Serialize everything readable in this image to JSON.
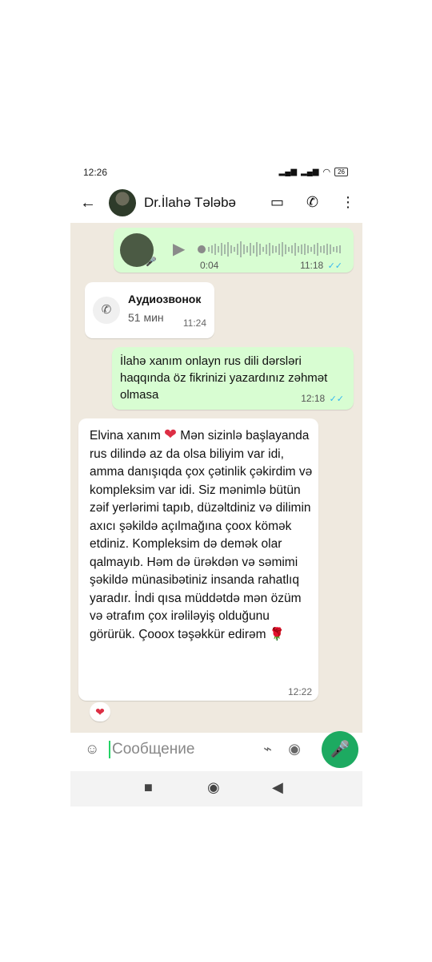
{
  "status": {
    "time": "12:26",
    "battery": "26"
  },
  "header": {
    "contact_name": "Dr.İlahə Tələbə"
  },
  "messages": {
    "voice": {
      "duration": "0:04",
      "time": "11:18"
    },
    "call": {
      "title": "Аудиозвонок",
      "duration": "51 мин",
      "time": "11:24"
    },
    "question": {
      "text": "İlahə xanım onlayn rus dili dərsləri haqqında öz fikrinizi yazardınız zəhmət olmasa",
      "time": "12:18"
    },
    "reply": {
      "text1": "Elvina xanım",
      "text2": "Mən sizinlə başlayanda rus dilində az da olsa biliyim var idi, amma danışıqda çox çətinlik çəkirdim və kompleksim var idi. Siz mənimlə bütün zəif yerlərimi tapıb, düzəltdiniz və dilimin axıcı şəkildə açılmağına çoox kömək etdiniz. Kompleksim də demək olar qalmayıb. Həm də ürəkdən və səmimi şəkildə münasibətiniz insanda rahatlıq yaradır. İndi qısa müddətdə mən özüm və ətrafım çox irəliləyiş olduğunu görürük.",
      "text3": "Çooox təşəkkür edirəm",
      "time": "12:22",
      "reaction": "❤"
    }
  },
  "composer": {
    "placeholder": "Сообщение"
  },
  "icons": {
    "back": "←",
    "video": "▭",
    "phone": "✆",
    "more": "⋮",
    "play": "▶",
    "call": "✆",
    "emoji": "☺",
    "attach": "⌁",
    "camera": "◉",
    "mic": "🎤",
    "nav_square": "■",
    "nav_home": "◉",
    "nav_back": "◀"
  },
  "colors": {
    "outgoing_bubble": "#d8fdd2",
    "chat_bg": "#efe9df",
    "mic_button": "#1daa61",
    "read_ticks": "#34b7f1"
  }
}
